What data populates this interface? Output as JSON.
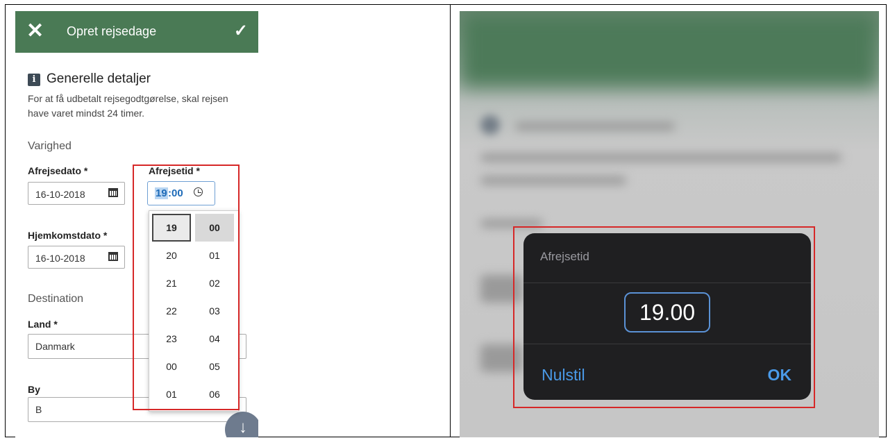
{
  "left": {
    "appbar": {
      "title": "Opret rejsedage",
      "close_glyph": "✕",
      "confirm_glyph": "✓"
    },
    "section": {
      "icon_glyph": "i",
      "title": "Generelle detaljer",
      "description": "For at få udbetalt rejsegodtgørelse, skal rejsen have varet mindst 24 timer."
    },
    "duration": {
      "heading": "Varighed",
      "departure_date_label": "Afrejsedato *",
      "departure_date_value": "16-10-2018",
      "departure_time_label": "Afrejsetid *",
      "departure_time_hour": "19",
      "departure_time_minute": "00",
      "return_date_label": "Hjemkomstdato *",
      "return_date_value": "16-10-2018"
    },
    "destination": {
      "heading": "Destination",
      "country_label": "Land *",
      "country_value": "Danmark",
      "city_label": "By",
      "city_value": "B"
    },
    "time_picker": {
      "hours": [
        "19",
        "20",
        "21",
        "22",
        "23",
        "00",
        "01"
      ],
      "minutes": [
        "00",
        "01",
        "02",
        "03",
        "04",
        "05",
        "06"
      ]
    },
    "fab_glyph": "↓"
  },
  "right": {
    "dialog": {
      "title": "Afrejsetid",
      "time_value": "19.00",
      "reset_label": "Nulstil",
      "ok_label": "OK"
    }
  },
  "colors": {
    "appbar": "#4a7a55",
    "highlight": "#d62828",
    "ios_accent": "#4a9ae8"
  }
}
